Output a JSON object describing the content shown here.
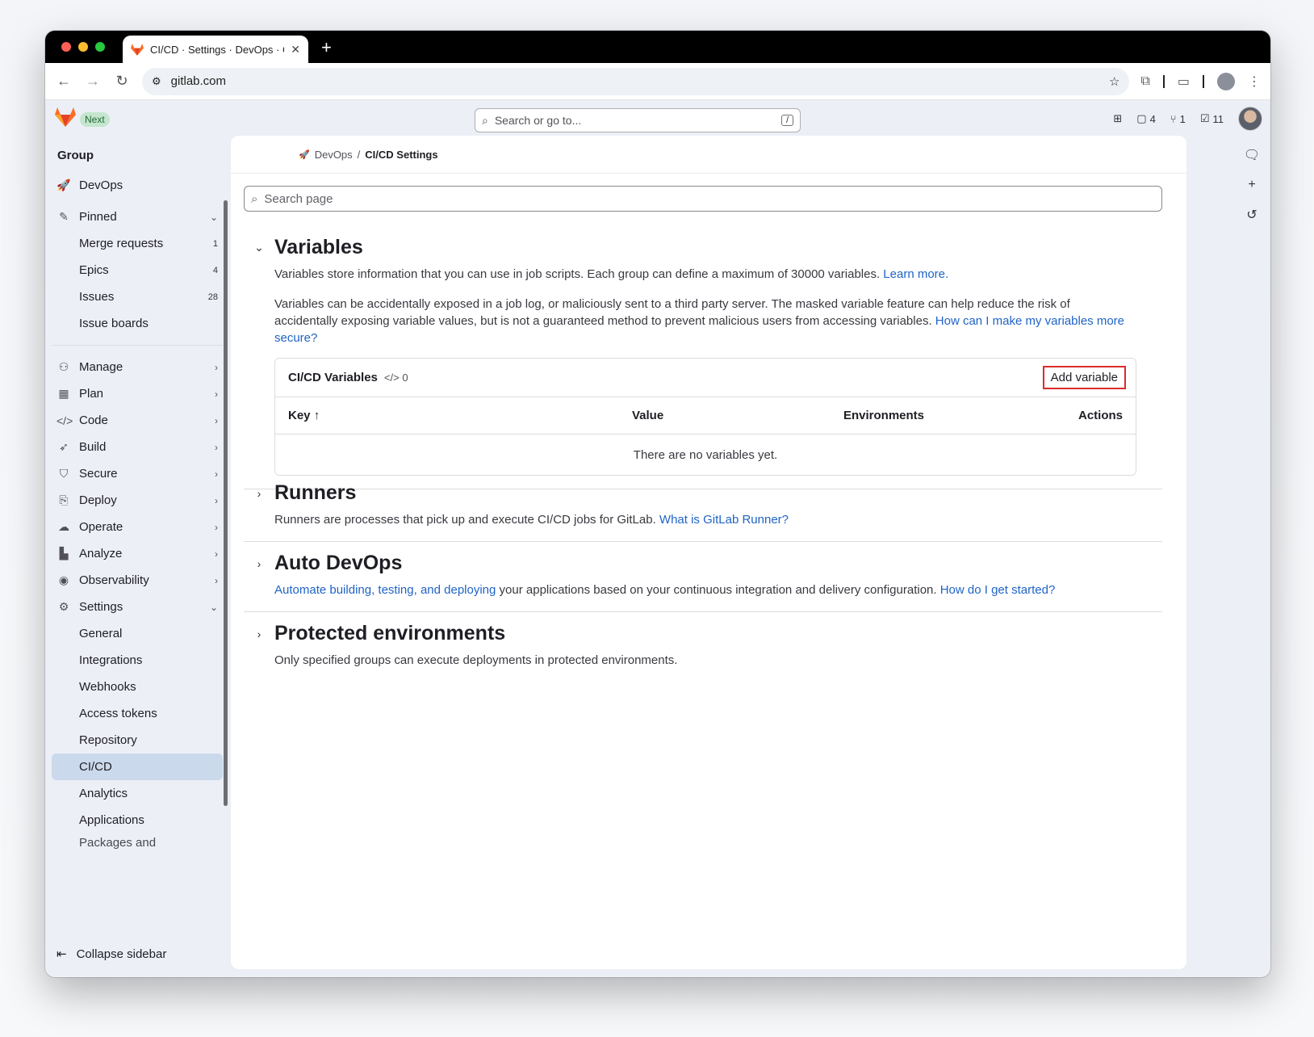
{
  "browser": {
    "tab_title": "CI/CD · Settings · DevOps · G",
    "url": "gitlab.com"
  },
  "topbar": {
    "badge": "Next",
    "search_placeholder": "Search or go to...",
    "search_shortcut": "/",
    "issues_count": "4",
    "mr_count": "1",
    "todos_count": "11"
  },
  "sidebar": {
    "heading": "Group",
    "group_name": "DevOps",
    "pinned_label": "Pinned",
    "pinned": [
      {
        "label": "Merge requests",
        "count": "1"
      },
      {
        "label": "Epics",
        "count": "4"
      },
      {
        "label": "Issues",
        "count": "28"
      },
      {
        "label": "Issue boards",
        "count": ""
      }
    ],
    "sections": [
      {
        "label": "Manage",
        "icon": "users-icon"
      },
      {
        "label": "Plan",
        "icon": "calendar-icon"
      },
      {
        "label": "Code",
        "icon": "code-icon"
      },
      {
        "label": "Build",
        "icon": "rocket-icon"
      },
      {
        "label": "Secure",
        "icon": "shield-icon"
      },
      {
        "label": "Deploy",
        "icon": "deploy-icon"
      },
      {
        "label": "Operate",
        "icon": "cloud-icon"
      },
      {
        "label": "Analyze",
        "icon": "chart-icon"
      },
      {
        "label": "Observability",
        "icon": "eye-icon"
      }
    ],
    "settings_label": "Settings",
    "settings_items": [
      "General",
      "Integrations",
      "Webhooks",
      "Access tokens",
      "Repository",
      "CI/CD",
      "Analytics",
      "Applications",
      "Packages and"
    ],
    "active_item": "CI/CD",
    "collapse_label": "Collapse sidebar"
  },
  "breadcrumb": {
    "group": "DevOps",
    "separator": "/",
    "current": "CI/CD Settings"
  },
  "page_search_placeholder": "Search page",
  "variables": {
    "title": "Variables",
    "desc1": "Variables store information that you can use in job scripts. Each group can define a maximum of 30000 variables.",
    "desc1_link": "Learn more.",
    "desc2": "Variables can be accidentally exposed in a job log, or maliciously sent to a third party server. The masked variable feature can help reduce the risk of accidentally exposing variable values, but is not a guaranteed method to prevent malicious users from accessing variables.",
    "desc2_link": "How can I make my variables more secure?",
    "card_title": "CI/CD Variables",
    "count": "0",
    "add_button": "Add variable",
    "columns": [
      "Key",
      "Value",
      "Environments",
      "Actions"
    ],
    "empty_text": "There are no variables yet."
  },
  "runners": {
    "title": "Runners",
    "desc": "Runners are processes that pick up and execute CI/CD jobs for GitLab.",
    "link": "What is GitLab Runner?"
  },
  "autodevops": {
    "title": "Auto DevOps",
    "link1": "Automate building, testing, and deploying",
    "desc": "your applications based on your continuous integration and delivery configuration.",
    "link2": "How do I get started?"
  },
  "protected": {
    "title": "Protected environments",
    "desc": "Only specified groups can execute deployments in protected environments."
  },
  "colors": {
    "accent_link": "#1f63c7",
    "active_nav": "#cbd9ec",
    "highlight_box": "#dd2b2b"
  }
}
